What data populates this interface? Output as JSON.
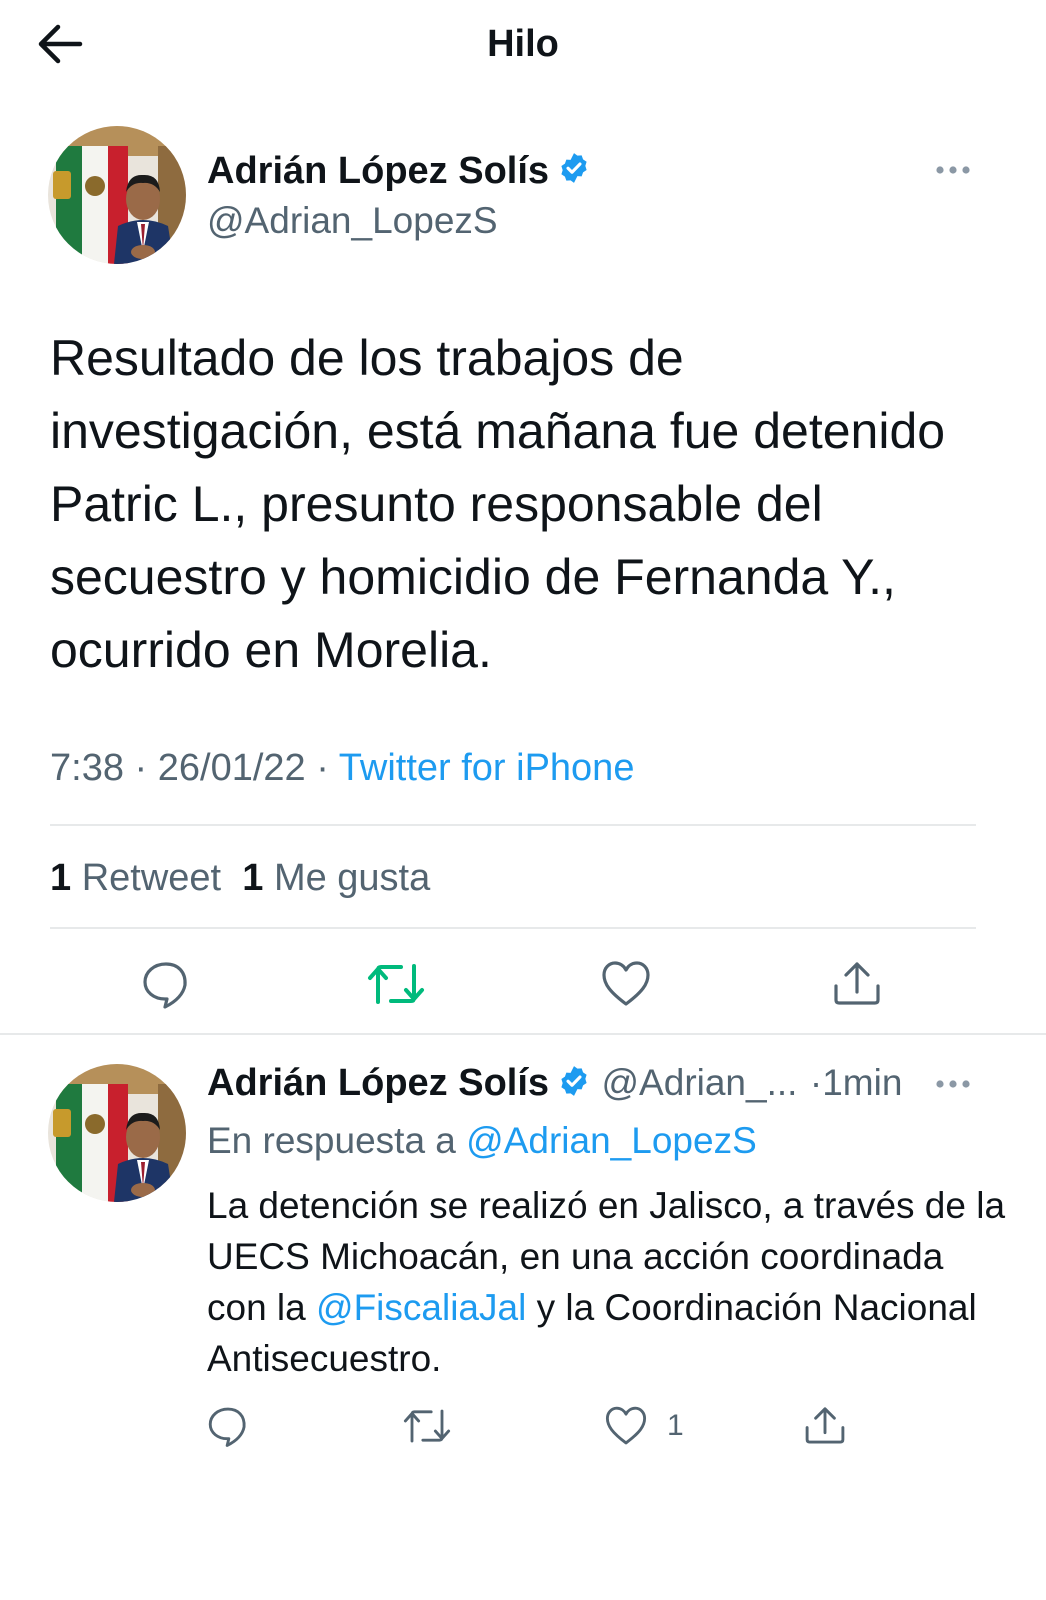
{
  "header": {
    "title": "Hilo"
  },
  "tweet": {
    "author_name": "Adrián López Solís",
    "author_handle": "@Adrian_LopezS",
    "text": "Resultado de los trabajos de investigación, está mañana fue detenido Patric L., presunto responsable del secuestro y homicidio de Fernanda Y., ocurrido en Morelia.",
    "time": "7:38",
    "date": "26/01/22",
    "separator": "·",
    "source": "Twitter for iPhone",
    "retweet_count": "1",
    "retweet_label": "Retweet",
    "like_count": "1",
    "like_label": "Me gusta"
  },
  "reply": {
    "author_name": "Adrián López Solís",
    "author_handle_truncated": "@Adrian_...",
    "time_ago": "·1min",
    "in_reply_prefix": "En respuesta a",
    "in_reply_handle": "@Adrian_LopezS",
    "text_part1": "La detención se realizó en Jalisco,  a través de la UECS Michoacán, en una acción coordinada con la",
    "mention": "@FiscaliaJal",
    "text_part2": "y la Coordinación Nacional Antisecuestro.",
    "like_count": "1"
  },
  "icons": {
    "back": "arrow-left-icon",
    "verified": "verified-badge-icon",
    "more": "more-dots-icon",
    "reply": "reply-bubble-icon",
    "retweet": "retweet-icon",
    "like": "heart-icon",
    "share": "share-upload-icon"
  },
  "colors": {
    "text": "#0f1419",
    "secondary": "#536471",
    "link": "#1d9bf0",
    "retweet_active": "#00ba7c",
    "divider": "#e7e9ea"
  }
}
